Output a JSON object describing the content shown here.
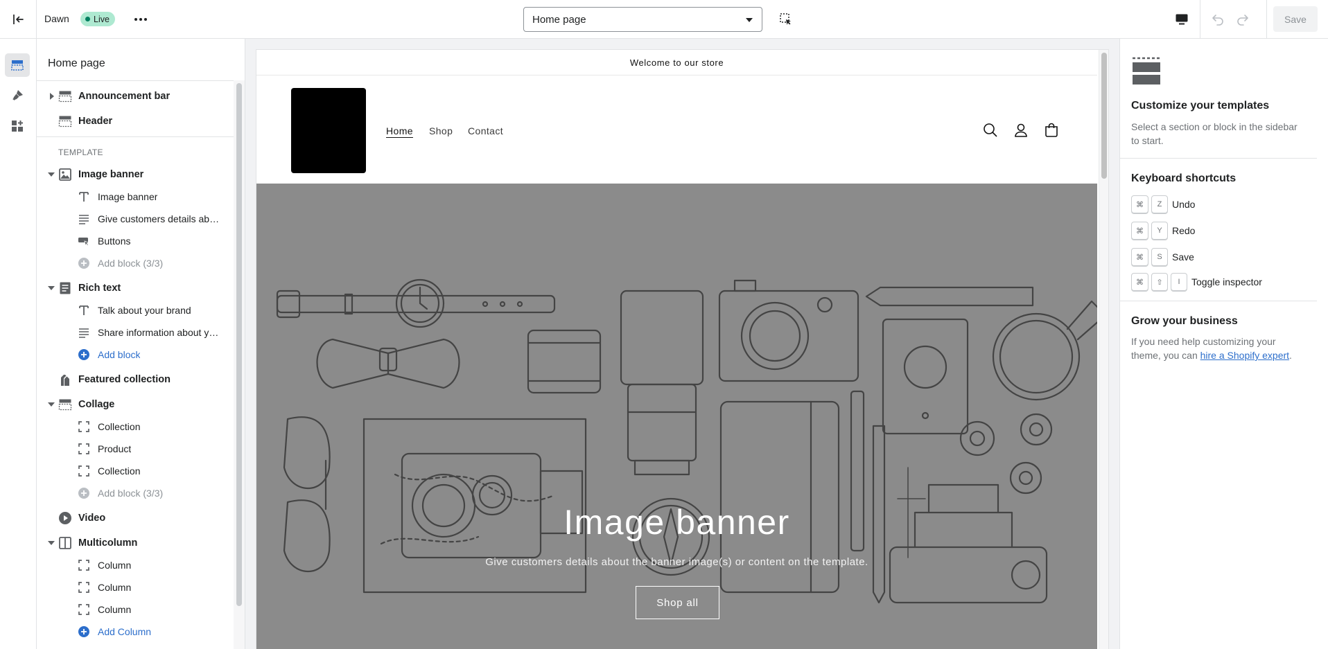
{
  "topbar": {
    "theme_name": "Dawn",
    "live_badge": "Live",
    "page_select": "Home page",
    "save_label": "Save"
  },
  "sidebar": {
    "title": "Home page",
    "template_label": "TEMPLATE",
    "announcement_bar": "Announcement bar",
    "header": "Header",
    "image_banner": {
      "label": "Image banner",
      "blocks": [
        "Image banner",
        "Give customers details about the banner image(s) or content on the template.",
        "Buttons"
      ],
      "add": "Add block (3/3)"
    },
    "rich_text": {
      "label": "Rich text",
      "blocks": [
        "Talk about your brand",
        "Share information about your brand with your customers."
      ],
      "add": "Add block"
    },
    "featured_collection": "Featured collection",
    "collage": {
      "label": "Collage",
      "blocks": [
        "Collection",
        "Product",
        "Collection"
      ],
      "add": "Add block (3/3)"
    },
    "video": "Video",
    "multicolumn": {
      "label": "Multicolumn",
      "blocks": [
        "Column",
        "Column",
        "Column"
      ],
      "add": "Add Column"
    }
  },
  "preview": {
    "announcement": "Welcome to our store",
    "nav": [
      "Home",
      "Shop",
      "Contact"
    ],
    "banner_title": "Image banner",
    "banner_text": "Give customers details about the banner image(s) or content on the template.",
    "banner_button": "Shop all"
  },
  "rpanel": {
    "customize_title": "Customize your templates",
    "customize_text": "Select a section or block in the sidebar to start.",
    "shortcuts_title": "Keyboard shortcuts",
    "shortcuts": [
      {
        "keys": [
          "⌘",
          "Z"
        ],
        "label": "Undo"
      },
      {
        "keys": [
          "⌘",
          "Y"
        ],
        "label": "Redo"
      },
      {
        "keys": [
          "⌘",
          "S"
        ],
        "label": "Save"
      },
      {
        "keys": [
          "⌘",
          "⇧",
          "I"
        ],
        "label": "Toggle inspector"
      }
    ],
    "grow_title": "Grow your business",
    "grow_text_before": "If you need help customizing your theme, you can ",
    "grow_link": "hire a Shopify expert",
    "grow_text_after": "."
  },
  "colors": {
    "accent": "#2c6ecb",
    "live_badge_bg": "#aee9d1",
    "banner_bg": "#8b8b8b"
  }
}
